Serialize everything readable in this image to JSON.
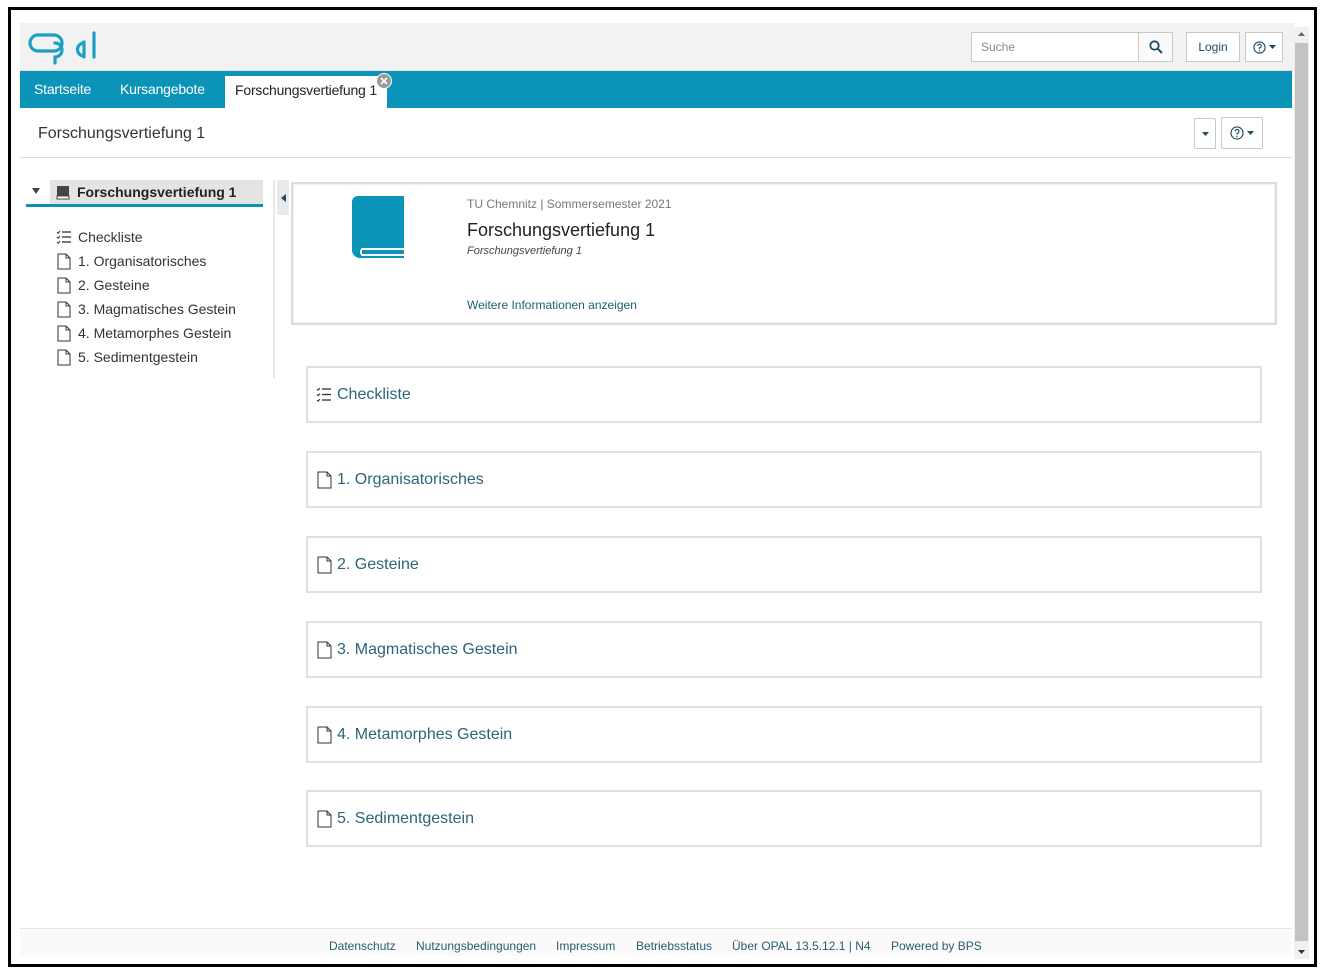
{
  "header": {
    "logo_text": "Opal",
    "search_placeholder": "Suche",
    "login_label": "Login"
  },
  "nav": {
    "tabs": [
      {
        "label": "Startseite"
      },
      {
        "label": "Kursangebote"
      },
      {
        "label": "Forschungsvertiefung 1",
        "active": true
      }
    ]
  },
  "course": {
    "title": "Forschungsvertiefung 1"
  },
  "tree": {
    "root_label": "Forschungsvertiefung 1",
    "items": [
      {
        "label": "Checkliste",
        "icon": "checklist-icon"
      },
      {
        "label": "1. Organisatorisches",
        "icon": "page-icon"
      },
      {
        "label": "2. Gesteine",
        "icon": "page-icon"
      },
      {
        "label": "3. Magmatisches Gestein",
        "icon": "page-icon"
      },
      {
        "label": "4. Metamorphes Gestein",
        "icon": "page-icon"
      },
      {
        "label": "5. Sedimentgestein",
        "icon": "page-icon"
      }
    ]
  },
  "info": {
    "meta": "TU Chemnitz | Sommersemester 2021",
    "title": "Forschungsvertiefung 1",
    "subtitle": "Forschungsvertiefung 1",
    "more_link": "Weitere Informationen anzeigen"
  },
  "cards": [
    {
      "label": "Checkliste",
      "icon": "checklist-icon"
    },
    {
      "label": "1. Organisatorisches",
      "icon": "page-icon"
    },
    {
      "label": "2. Gesteine",
      "icon": "page-icon"
    },
    {
      "label": "3. Magmatisches Gestein",
      "icon": "page-icon"
    },
    {
      "label": "4. Metamorphes Gestein",
      "icon": "page-icon"
    },
    {
      "label": "5. Sedimentgestein",
      "icon": "page-icon"
    }
  ],
  "footer": {
    "links": [
      "Datenschutz",
      "Nutzungsbedingungen",
      "Impressum",
      "Betriebsstatus",
      "Über OPAL 13.5.12.1 | N4",
      "Powered by BPS"
    ]
  },
  "colors": {
    "brand": "#0b93b8",
    "link": "#2a6578"
  }
}
